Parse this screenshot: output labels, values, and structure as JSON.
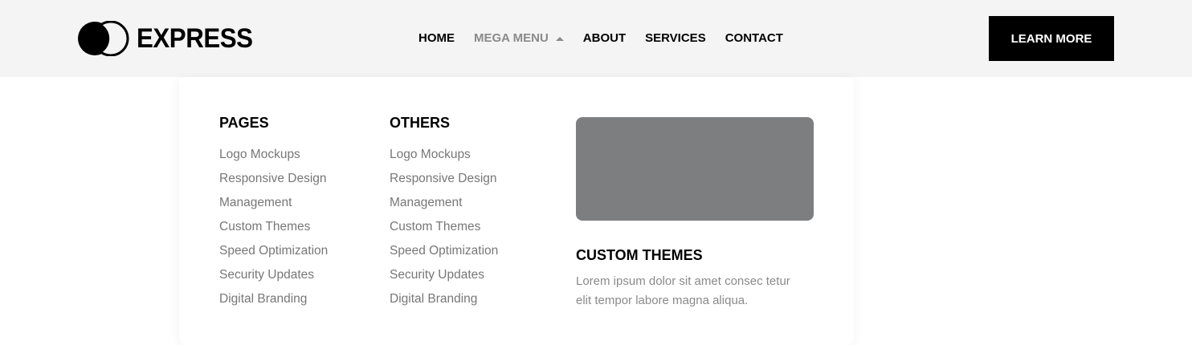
{
  "header": {
    "logo": {
      "icon": "double-circle-logo-icon",
      "text": "EXPRESS"
    },
    "nav": [
      {
        "label": "HOME"
      },
      {
        "label": "MEGA MENU",
        "active": true,
        "icon": "caret-up-icon"
      },
      {
        "label": "ABOUT"
      },
      {
        "label": "SERVICES"
      },
      {
        "label": "CONTACT"
      }
    ],
    "cta_label": "LEARN MORE"
  },
  "mega_menu": {
    "pages": {
      "title": "PAGES",
      "links": [
        "Logo Mockups",
        "Responsive Design",
        "Management",
        "Custom Themes",
        "Speed Optimization",
        "Security Updates",
        "Digital Branding"
      ]
    },
    "others": {
      "title": "OTHERS",
      "links": [
        "Logo Mockups",
        "Responsive Design",
        "Management",
        "Custom Themes",
        "Speed Optimization",
        "Security Updates",
        "Digital Branding"
      ]
    },
    "feature": {
      "title": "CUSTOM THEMES",
      "text": "Lorem ipsum dolor sit amet consec tetur elit tempor labore magna aliqua."
    }
  },
  "colors": {
    "header_bg": "#f4f4f4",
    "cta_bg": "#000000",
    "active_nav": "#8a8a8a",
    "link_gray": "#777777",
    "image_placeholder": "#7d7e80"
  }
}
